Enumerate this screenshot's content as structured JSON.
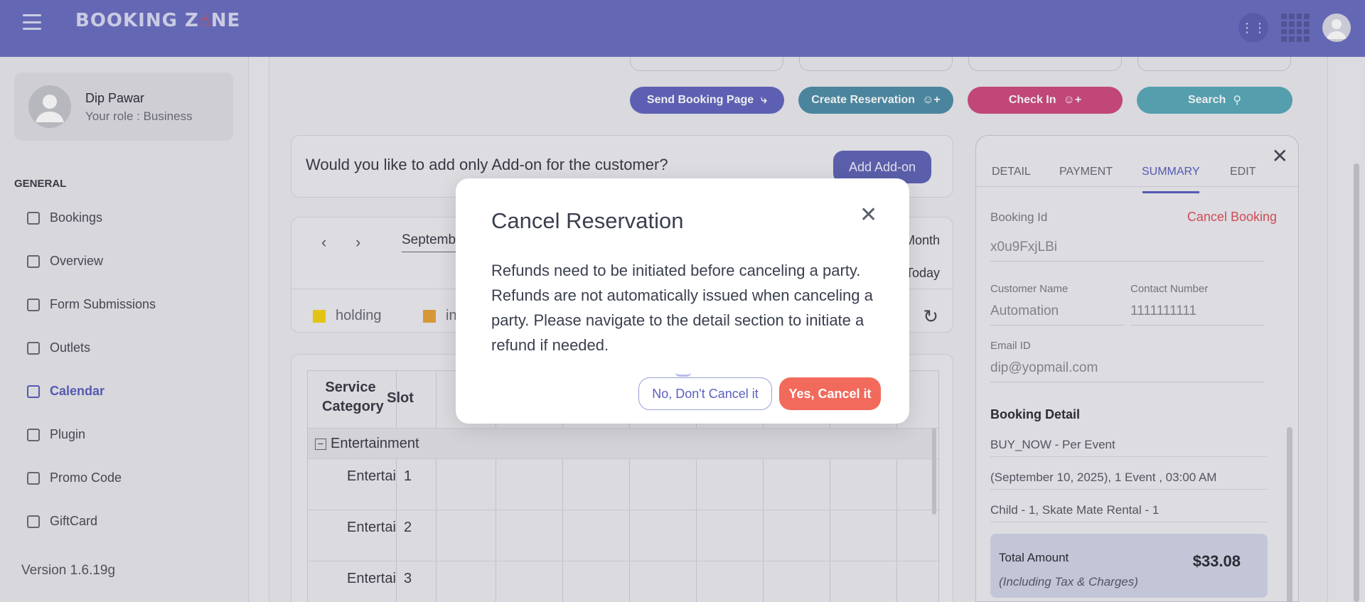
{
  "header": {
    "logo_text_before": "BOOKING Z",
    "logo_text_after": "NE",
    "icons": [
      "menu-icon",
      "filter-sliders-icon",
      "qr-code-icon",
      "user-avatar-icon"
    ]
  },
  "sidebar": {
    "user_name": "Dip Pawar",
    "user_role": "Your role : Business",
    "section_title": "GENERAL",
    "items": [
      {
        "label": "Bookings",
        "icon": "bookings-icon"
      },
      {
        "label": "Overview",
        "icon": "chart-icon"
      },
      {
        "label": "Form Submissions",
        "icon": "form-icon"
      },
      {
        "label": "Outlets",
        "icon": "store-icon"
      },
      {
        "label": "Calendar",
        "icon": "calendar-icon",
        "active": true
      },
      {
        "label": "Plugin",
        "icon": "external-link-icon"
      },
      {
        "label": "Promo Code",
        "icon": "ticket-icon"
      },
      {
        "label": "GiftCard",
        "icon": "gift-icon"
      }
    ],
    "version": "Version 1.6.19g"
  },
  "actions": {
    "send_booking_page": "Send Booking Page",
    "create_reservation": "Create Reservation",
    "check_in": "Check In",
    "search": "Search"
  },
  "addon": {
    "question": "Would you like to add only Add-on for the customer?",
    "button": "Add Add-on"
  },
  "calendar": {
    "month_value": "Septemb",
    "view_label": "Month",
    "today_label": "Today",
    "legend": [
      {
        "label": "holding",
        "color": "#f5d313"
      },
      {
        "label": "ini",
        "color": "#e8a23a"
      }
    ]
  },
  "table": {
    "headers": {
      "service_category": "Service Category",
      "slot": "Slot"
    },
    "group": "Entertainment",
    "rows": [
      {
        "category": "Entertai",
        "slot": "1"
      },
      {
        "category": "Entertai",
        "slot": "2"
      },
      {
        "category": "Entertai",
        "slot": "3"
      }
    ]
  },
  "detail_panel": {
    "tabs": [
      "DETAIL",
      "PAYMENT",
      "SUMMARY",
      "EDIT"
    ],
    "active_tab": "SUMMARY",
    "booking_id_label": "Booking Id",
    "booking_id": "x0u9FxjLBi",
    "cancel_booking": "Cancel Booking",
    "customer_name_label": "Customer Name",
    "customer_name": "Automation",
    "contact_label": "Contact Number",
    "contact": "1111111111",
    "email_label": "Email ID",
    "email": "dip@yopmail.com",
    "booking_detail_title": "Booking Detail",
    "booking_lines": [
      "BUY_NOW - Per Event",
      "(September 10, 2025), 1 Event , 03:00 AM",
      "Child - 1, Skate Mate Rental - 1"
    ],
    "total_label": "Total Amount",
    "total_sub": "(Including Tax & Charges)",
    "total_amount": "$33.08"
  },
  "modal": {
    "title": "Cancel Reservation",
    "body": "Refunds need to be initiated before canceling a party. Refunds are not automatically issued when canceling a party. Please navigate to the detail section to initiate a refund if needed.",
    "no_button": "No, Don't Cancel it",
    "yes_button": "Yes, Cancel it"
  }
}
